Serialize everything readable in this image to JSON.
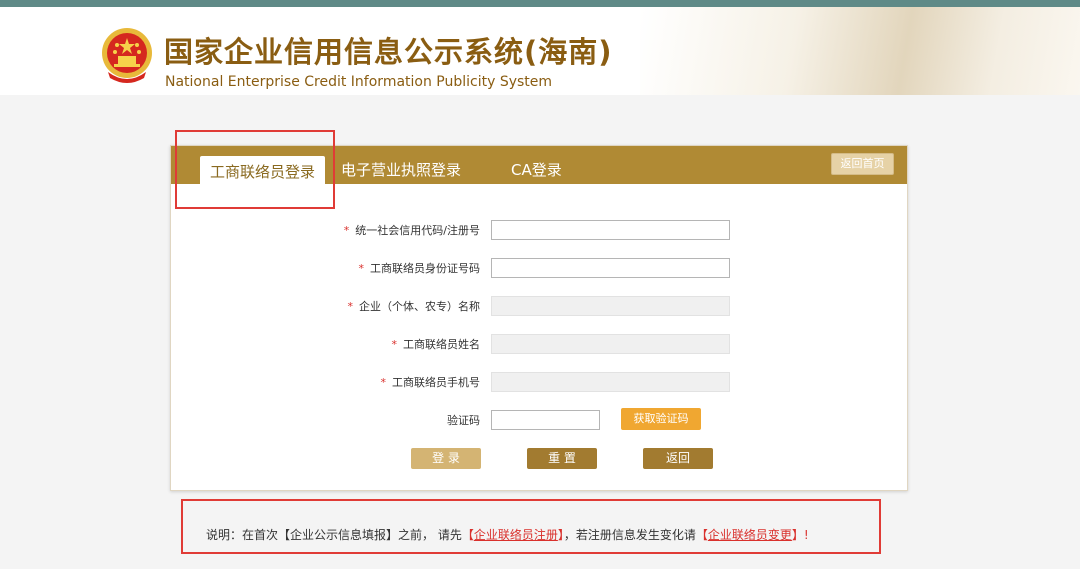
{
  "header": {
    "title_cn": "国家企业信用信息公示系统(海南)",
    "title_en": "National Enterprise Credit Information Publicity System"
  },
  "tabs": [
    {
      "label": "工商联络员登录",
      "active": true
    },
    {
      "label": "电子营业执照登录",
      "active": false
    },
    {
      "label": "CA登录",
      "active": false
    }
  ],
  "home_button": "返回首页",
  "form": {
    "fields": [
      {
        "label": "统一社会信用代码/注册号",
        "required": true,
        "value": ""
      },
      {
        "label": "工商联络员身份证号码",
        "required": true,
        "value": ""
      },
      {
        "label": "企业（个体、农专）名称",
        "required": true,
        "value": ""
      },
      {
        "label": "工商联络员姓名",
        "required": true,
        "value": ""
      },
      {
        "label": "工商联络员手机号",
        "required": true,
        "value": ""
      }
    ],
    "captcha_label": "验证码",
    "get_code_button": "获取验证码",
    "required_mark": "*"
  },
  "buttons": {
    "login": "登 录",
    "reset": "重 置",
    "back": "返回"
  },
  "note": {
    "prefix": "说明：在首次【企业公示信息填报】之前，  请先",
    "bracket_open": "【",
    "link1": "企业联络员注册",
    "bracket_close": "】",
    "middle": "，若注册信息发生变化请",
    "link2": "企业联络员变更",
    "suffix": "】!"
  },
  "colors": {
    "tabbar": "#b08a34",
    "title": "#8a5d12",
    "accent_orange": "#f0a731",
    "highlight_red": "#e03b36"
  }
}
